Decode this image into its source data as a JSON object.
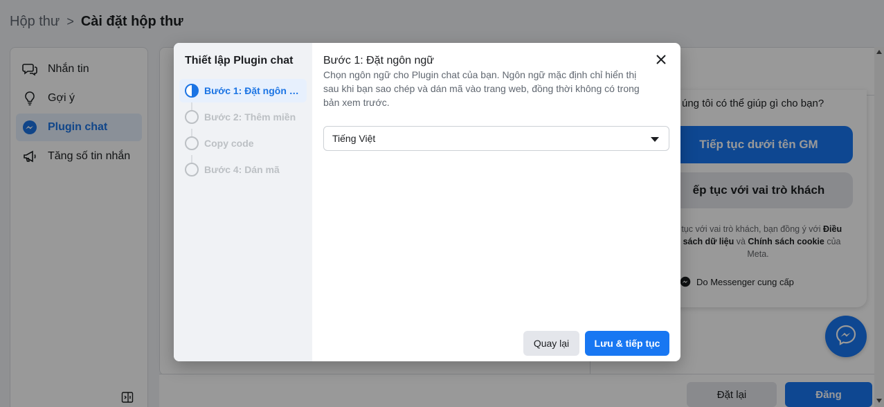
{
  "breadcrumb": {
    "parent": "Hộp thư",
    "separator": ">",
    "current": "Cài đặt hộp thư"
  },
  "sidebar": {
    "items": [
      {
        "label": "Nhắn tin",
        "icon": "chat-bubbles-icon",
        "active": false
      },
      {
        "label": "Gợi ý",
        "icon": "lightbulb-icon",
        "active": false
      },
      {
        "label": "Plugin chat",
        "icon": "messenger-icon",
        "active": true
      },
      {
        "label": "Tăng số tin nhắn",
        "icon": "megaphone-icon",
        "active": false
      }
    ],
    "toggle_icon": "sidebar-toggle-icon"
  },
  "preview": {
    "question": "úng tôi có thể giúp gì cho bạn?",
    "primary_button": "Tiếp tục dưới tên GM",
    "secondary_button": "ếp tục với vai trò khách",
    "terms_prefix": "p tục với vai trò khách, bạn đồng ý với ",
    "terms_link_1": "Điều",
    "terms_line2_link": "h sách dữ liệu",
    "terms_and": " và ",
    "terms_link_2": "Chính sách cookie",
    "terms_suffix": " của",
    "terms_line3": "Meta.",
    "powered_by": "Do Messenger cung cấp"
  },
  "footer": {
    "reset_label": "Đặt lại",
    "post_label": "Đăng"
  },
  "modal": {
    "steps_title": "Thiết lập Plugin chat",
    "steps": [
      {
        "label": "Bước 1: Đặt ngôn n...",
        "active": true
      },
      {
        "label": "Bước 2: Thêm miền",
        "active": false
      },
      {
        "label": "Copy code",
        "active": false
      },
      {
        "label": "Bước 4: Dán mã",
        "active": false
      }
    ],
    "content_title": "Bước 1: Đặt ngôn ngữ",
    "content_description": "Chọn ngôn ngữ cho Plugin chat của bạn. Ngôn ngữ mặc định chỉ hiển thị sau khi bạn sao chép và dán mã vào trang web, đồng thời không có trong bản xem trước.",
    "language_selected": "Tiếng Việt",
    "back_label": "Quay lại",
    "save_label": "Lưu & tiếp tục"
  },
  "colors": {
    "brand_blue": "#1877f2",
    "active_text": "#1b74e4",
    "active_bg": "#e7f0fd",
    "overlay": "rgba(0,0,0,0.4)"
  }
}
